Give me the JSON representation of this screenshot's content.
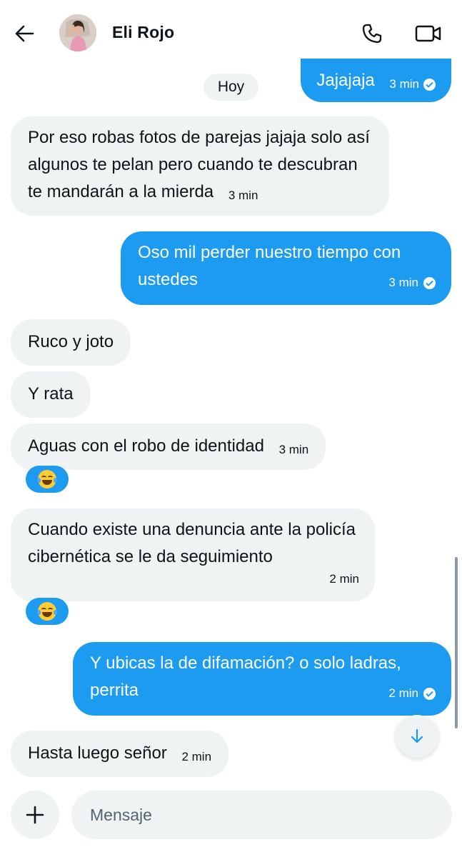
{
  "header": {
    "title": "Eli Rojo",
    "icons": {
      "back": "arrow-left-icon",
      "call": "phone-icon",
      "video": "video-camera-icon"
    }
  },
  "day_separator": "Hoy",
  "messages": [
    {
      "side": "out",
      "text": "Jajajaja",
      "time": "3 min",
      "read": true
    },
    {
      "side": "in",
      "text": "Por eso robas fotos de parejas jajaja solo así algunos te pelan pero cuando te descubran te mandarán a la mierda",
      "time": "3 min"
    },
    {
      "side": "out",
      "text": "Oso mil perder nuestro tiempo con ustedes",
      "time": "3 min",
      "read": true
    },
    {
      "side": "in",
      "text": "Ruco y joto"
    },
    {
      "side": "in",
      "text": "Y rata"
    },
    {
      "side": "in",
      "text": "Aguas con el robo de identidad",
      "time": "3 min",
      "reaction": "😂"
    },
    {
      "side": "in",
      "text": "Cuando existe una denuncia ante la policía cibernética se le da seguimiento",
      "time": "2 min",
      "reaction": "😂"
    },
    {
      "side": "out",
      "text": "Y ubicas la de difamación? o solo ladras, perrita",
      "time": "2 min",
      "read": true
    },
    {
      "side": "in",
      "text": "Hasta luego señor",
      "time": "2 min"
    }
  ],
  "composer": {
    "placeholder": "Mensaje",
    "add_icon": "plus-icon"
  },
  "scroll_down_icon": "arrow-down-icon",
  "colors": {
    "accent": "#1d9bf0",
    "incoming_bubble": "#eff3f4",
    "text": "#0f1419"
  }
}
